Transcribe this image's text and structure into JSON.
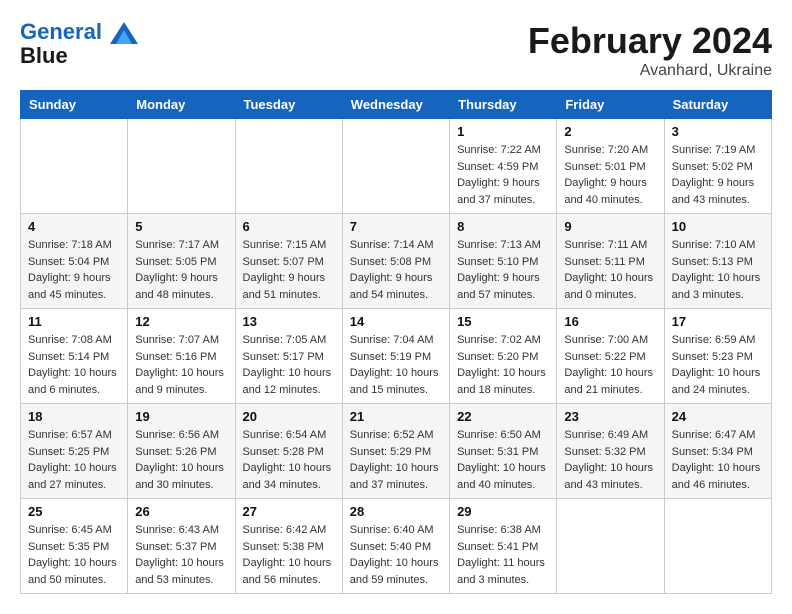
{
  "header": {
    "logo_line1": "General",
    "logo_line2": "Blue",
    "month": "February 2024",
    "location": "Avanhard, Ukraine"
  },
  "weekdays": [
    "Sunday",
    "Monday",
    "Tuesday",
    "Wednesday",
    "Thursday",
    "Friday",
    "Saturday"
  ],
  "weeks": [
    [
      {
        "day": "",
        "sunrise": "",
        "sunset": "",
        "daylight": ""
      },
      {
        "day": "",
        "sunrise": "",
        "sunset": "",
        "daylight": ""
      },
      {
        "day": "",
        "sunrise": "",
        "sunset": "",
        "daylight": ""
      },
      {
        "day": "",
        "sunrise": "",
        "sunset": "",
        "daylight": ""
      },
      {
        "day": "1",
        "sunrise": "7:22 AM",
        "sunset": "4:59 PM",
        "daylight": "9 hours and 37 minutes."
      },
      {
        "day": "2",
        "sunrise": "7:20 AM",
        "sunset": "5:01 PM",
        "daylight": "9 hours and 40 minutes."
      },
      {
        "day": "3",
        "sunrise": "7:19 AM",
        "sunset": "5:02 PM",
        "daylight": "9 hours and 43 minutes."
      }
    ],
    [
      {
        "day": "4",
        "sunrise": "7:18 AM",
        "sunset": "5:04 PM",
        "daylight": "9 hours and 45 minutes."
      },
      {
        "day": "5",
        "sunrise": "7:17 AM",
        "sunset": "5:05 PM",
        "daylight": "9 hours and 48 minutes."
      },
      {
        "day": "6",
        "sunrise": "7:15 AM",
        "sunset": "5:07 PM",
        "daylight": "9 hours and 51 minutes."
      },
      {
        "day": "7",
        "sunrise": "7:14 AM",
        "sunset": "5:08 PM",
        "daylight": "9 hours and 54 minutes."
      },
      {
        "day": "8",
        "sunrise": "7:13 AM",
        "sunset": "5:10 PM",
        "daylight": "9 hours and 57 minutes."
      },
      {
        "day": "9",
        "sunrise": "7:11 AM",
        "sunset": "5:11 PM",
        "daylight": "10 hours and 0 minutes."
      },
      {
        "day": "10",
        "sunrise": "7:10 AM",
        "sunset": "5:13 PM",
        "daylight": "10 hours and 3 minutes."
      }
    ],
    [
      {
        "day": "11",
        "sunrise": "7:08 AM",
        "sunset": "5:14 PM",
        "daylight": "10 hours and 6 minutes."
      },
      {
        "day": "12",
        "sunrise": "7:07 AM",
        "sunset": "5:16 PM",
        "daylight": "10 hours and 9 minutes."
      },
      {
        "day": "13",
        "sunrise": "7:05 AM",
        "sunset": "5:17 PM",
        "daylight": "10 hours and 12 minutes."
      },
      {
        "day": "14",
        "sunrise": "7:04 AM",
        "sunset": "5:19 PM",
        "daylight": "10 hours and 15 minutes."
      },
      {
        "day": "15",
        "sunrise": "7:02 AM",
        "sunset": "5:20 PM",
        "daylight": "10 hours and 18 minutes."
      },
      {
        "day": "16",
        "sunrise": "7:00 AM",
        "sunset": "5:22 PM",
        "daylight": "10 hours and 21 minutes."
      },
      {
        "day": "17",
        "sunrise": "6:59 AM",
        "sunset": "5:23 PM",
        "daylight": "10 hours and 24 minutes."
      }
    ],
    [
      {
        "day": "18",
        "sunrise": "6:57 AM",
        "sunset": "5:25 PM",
        "daylight": "10 hours and 27 minutes."
      },
      {
        "day": "19",
        "sunrise": "6:56 AM",
        "sunset": "5:26 PM",
        "daylight": "10 hours and 30 minutes."
      },
      {
        "day": "20",
        "sunrise": "6:54 AM",
        "sunset": "5:28 PM",
        "daylight": "10 hours and 34 minutes."
      },
      {
        "day": "21",
        "sunrise": "6:52 AM",
        "sunset": "5:29 PM",
        "daylight": "10 hours and 37 minutes."
      },
      {
        "day": "22",
        "sunrise": "6:50 AM",
        "sunset": "5:31 PM",
        "daylight": "10 hours and 40 minutes."
      },
      {
        "day": "23",
        "sunrise": "6:49 AM",
        "sunset": "5:32 PM",
        "daylight": "10 hours and 43 minutes."
      },
      {
        "day": "24",
        "sunrise": "6:47 AM",
        "sunset": "5:34 PM",
        "daylight": "10 hours and 46 minutes."
      }
    ],
    [
      {
        "day": "25",
        "sunrise": "6:45 AM",
        "sunset": "5:35 PM",
        "daylight": "10 hours and 50 minutes."
      },
      {
        "day": "26",
        "sunrise": "6:43 AM",
        "sunset": "5:37 PM",
        "daylight": "10 hours and 53 minutes."
      },
      {
        "day": "27",
        "sunrise": "6:42 AM",
        "sunset": "5:38 PM",
        "daylight": "10 hours and 56 minutes."
      },
      {
        "day": "28",
        "sunrise": "6:40 AM",
        "sunset": "5:40 PM",
        "daylight": "10 hours and 59 minutes."
      },
      {
        "day": "29",
        "sunrise": "6:38 AM",
        "sunset": "5:41 PM",
        "daylight": "11 hours and 3 minutes."
      },
      {
        "day": "",
        "sunrise": "",
        "sunset": "",
        "daylight": ""
      },
      {
        "day": "",
        "sunrise": "",
        "sunset": "",
        "daylight": ""
      }
    ]
  ]
}
